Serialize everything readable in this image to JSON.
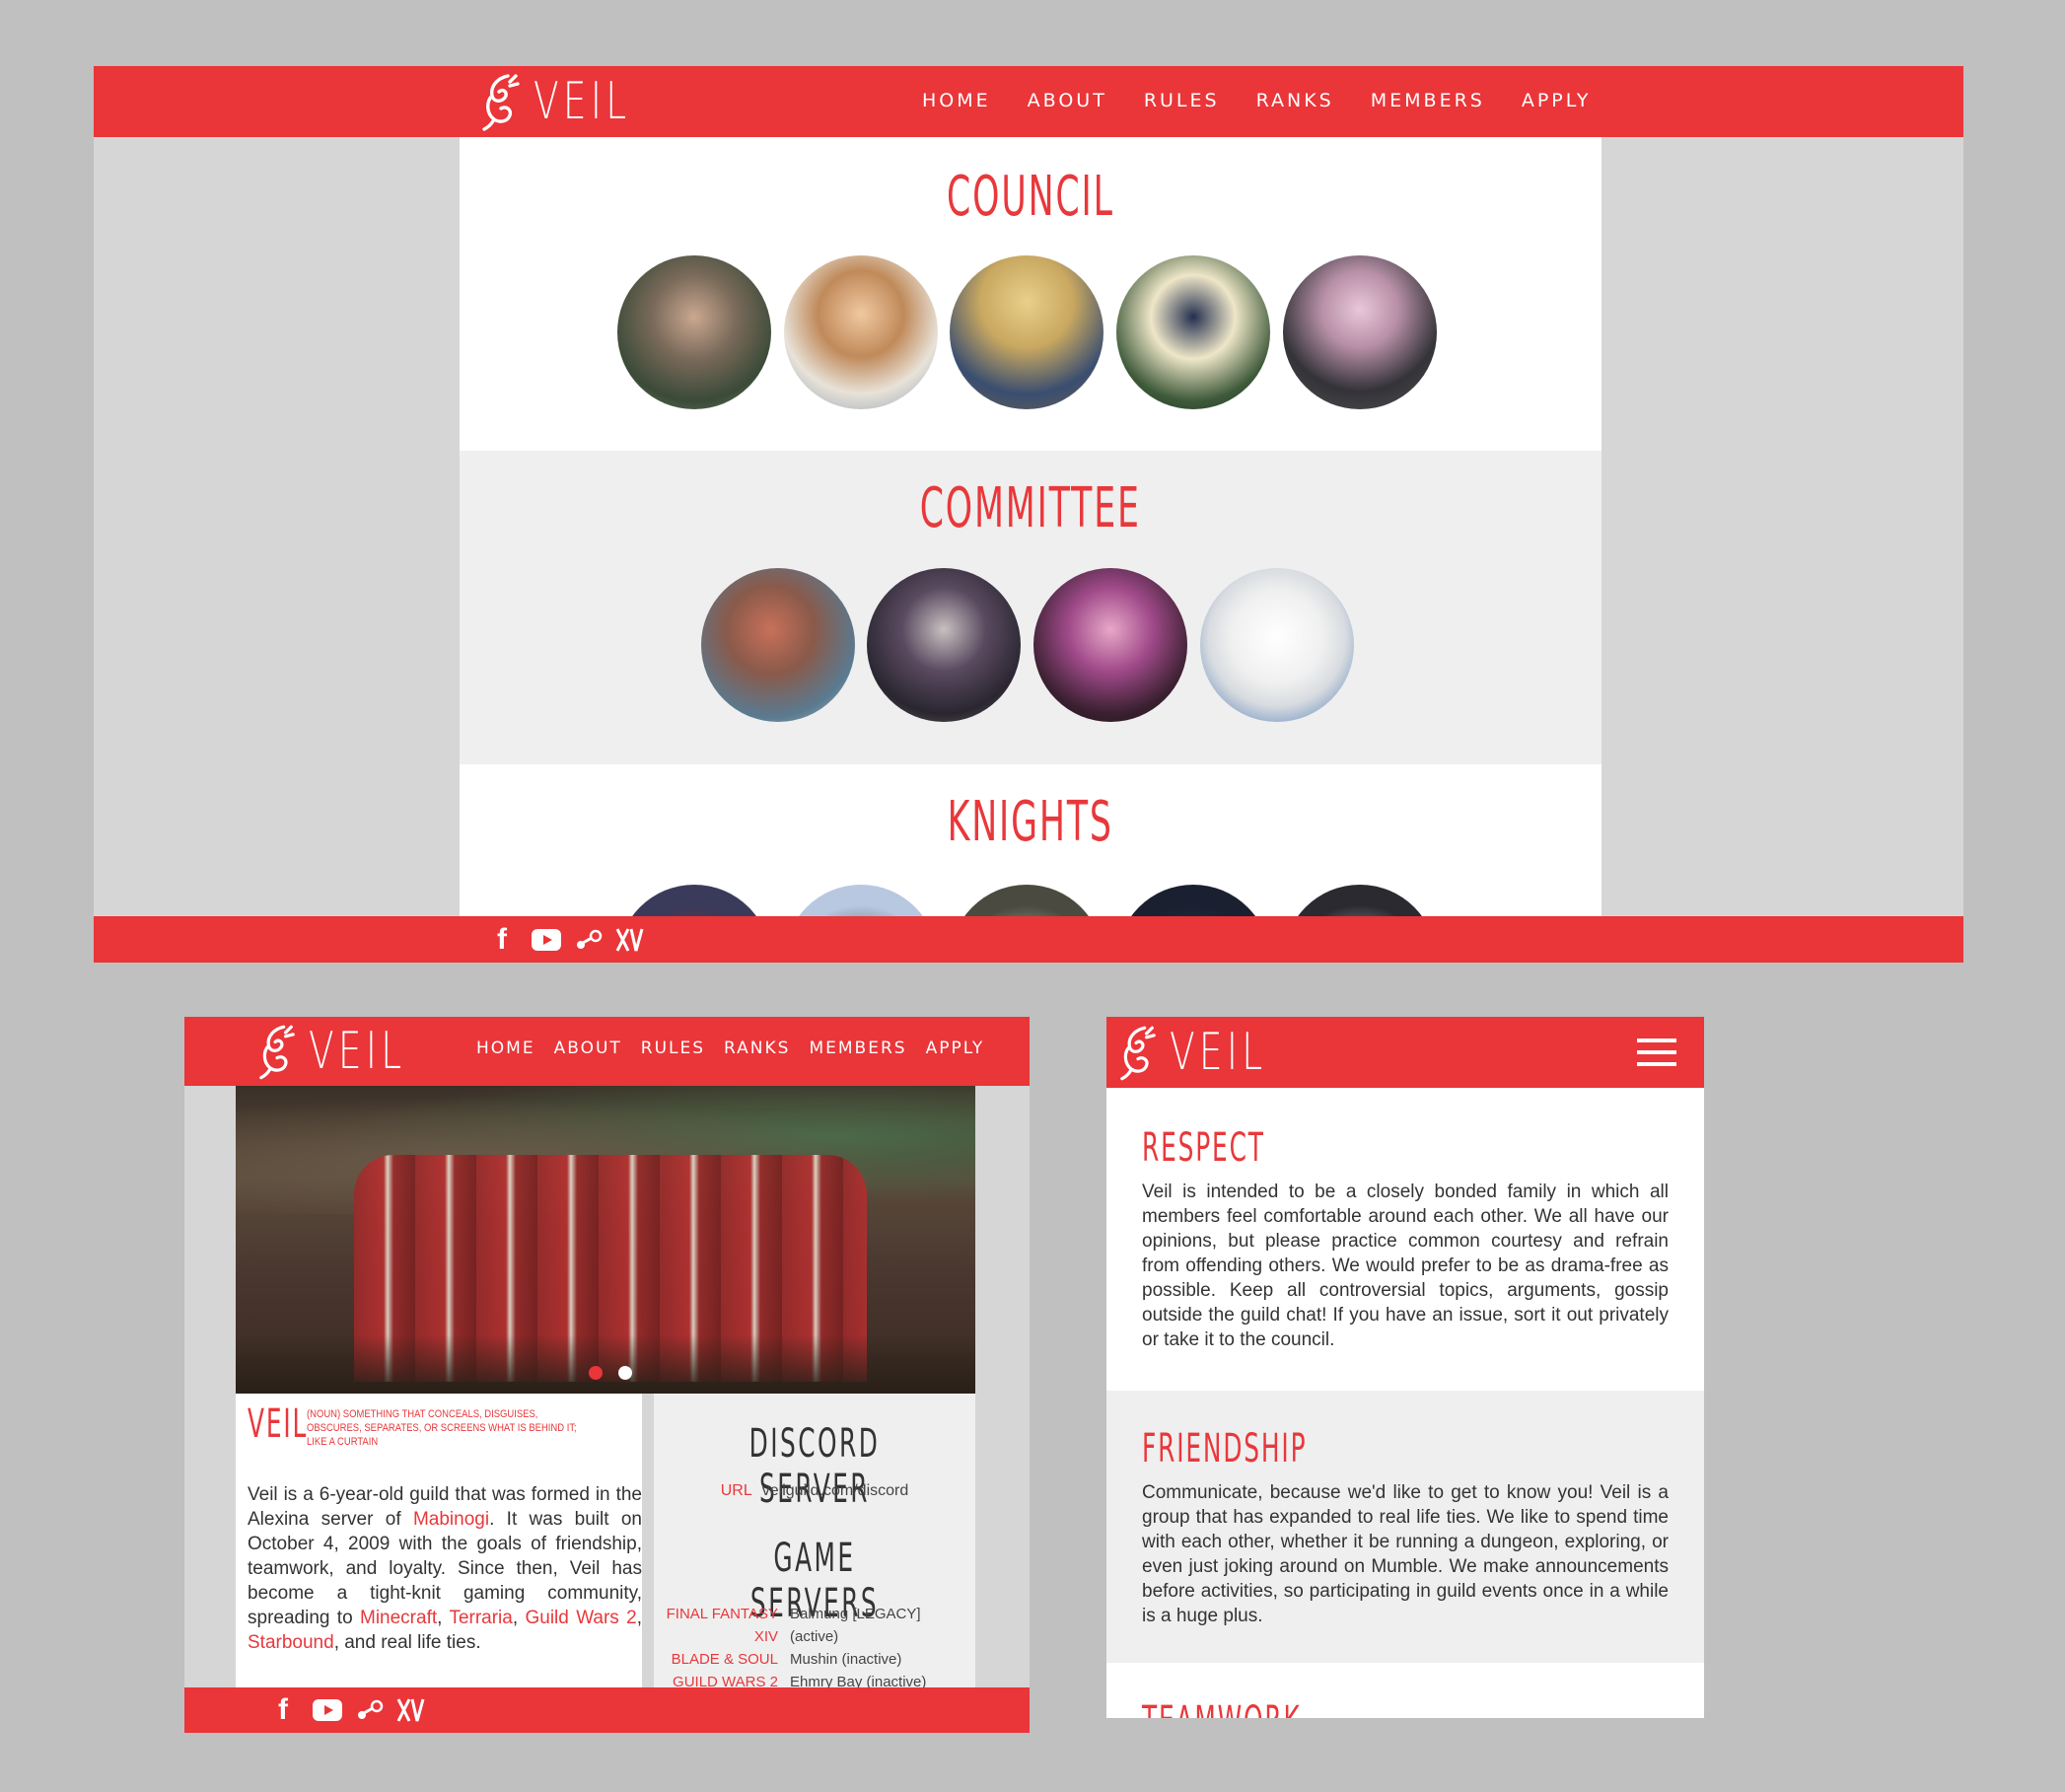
{
  "colors": {
    "brand_red": "#ea3539",
    "heading_red": "#e8383b",
    "page_bg": "#c0c0c0",
    "panel_gray": "#efefef"
  },
  "brand": {
    "name": "VEIL"
  },
  "nav": [
    "HOME",
    "ABOUT",
    "RULES",
    "RANKS",
    "MEMBERS",
    "APPLY"
  ],
  "social_icons": [
    "facebook-icon",
    "youtube-icon",
    "steam-icon",
    "ffxiv-icon"
  ],
  "ranks_page": {
    "sections": [
      {
        "title": "COUNCIL",
        "avatar_count": 5
      },
      {
        "title": "COMMITTEE",
        "avatar_count": 4
      },
      {
        "title": "KNIGHTS",
        "avatar_count": 5
      }
    ]
  },
  "home_page": {
    "slider": {
      "dot_count": 2,
      "active_dot": 1
    },
    "definition": {
      "word": "VEIL",
      "text": "(NOUN) SOMETHING THAT CONCEALS, DISGUISES, OBSCURES, SEPARATES, OR SCREENS WHAT IS BEHIND IT; LIKE A CURTAIN"
    },
    "about": {
      "p1": "Veil is a 6-year-old guild that was formed in the Alexina server of ",
      "link_mabinogi": "Mabinogi",
      "p2": ". It was built on October 4, 2009 with the goals of friendship, teamwork, and loyalty. Since then, Veil has become a tight-knit gaming community, spreading to ",
      "link_minecraft": "Minecraft",
      "comma1": ", ",
      "link_terraria": "Terraria",
      "comma2": ", ",
      "link_gw2": "Guild Wars 2",
      "comma3": ", ",
      "link_starbound": "Starbound",
      "p3": ", and real life ties."
    },
    "discord": {
      "title": "DISCORD SERVER",
      "url_label": "URL",
      "url_value": "veilguild.com/discord"
    },
    "game_servers": {
      "title": "GAME SERVERS",
      "rows": [
        {
          "game": "FINAL FANTASY XIV",
          "server": "Balmung [LEGACY] (active)"
        },
        {
          "game": "BLADE & SOUL",
          "server": "Mushin (inactive)"
        },
        {
          "game": "GUILD WARS 2",
          "server": "Ehmry Bay (inactive)"
        }
      ]
    }
  },
  "rules_page": {
    "sections": [
      {
        "title": "RESPECT",
        "text": "Veil is intended to be a closely bonded family in which all members feel comfortable around each other. We all have our opinions, but please practice common courtesy and refrain from offending others. We would prefer to be as drama-free as possible. Keep all controversial topics, arguments, gossip outside the guild chat! If you have an issue, sort it out privately or take it to the council."
      },
      {
        "title": "FRIENDSHIP",
        "text": "Communicate, because we'd like to get to know you! Veil is a group that has expanded to real life ties. We like to spend time with each other, whether it be running a dungeon, exploring, or even just joking around on Mumble. We make announcements before activities, so participating in guild events once in a while is a huge plus."
      },
      {
        "title": "TEAMWORK",
        "text": ""
      }
    ]
  }
}
